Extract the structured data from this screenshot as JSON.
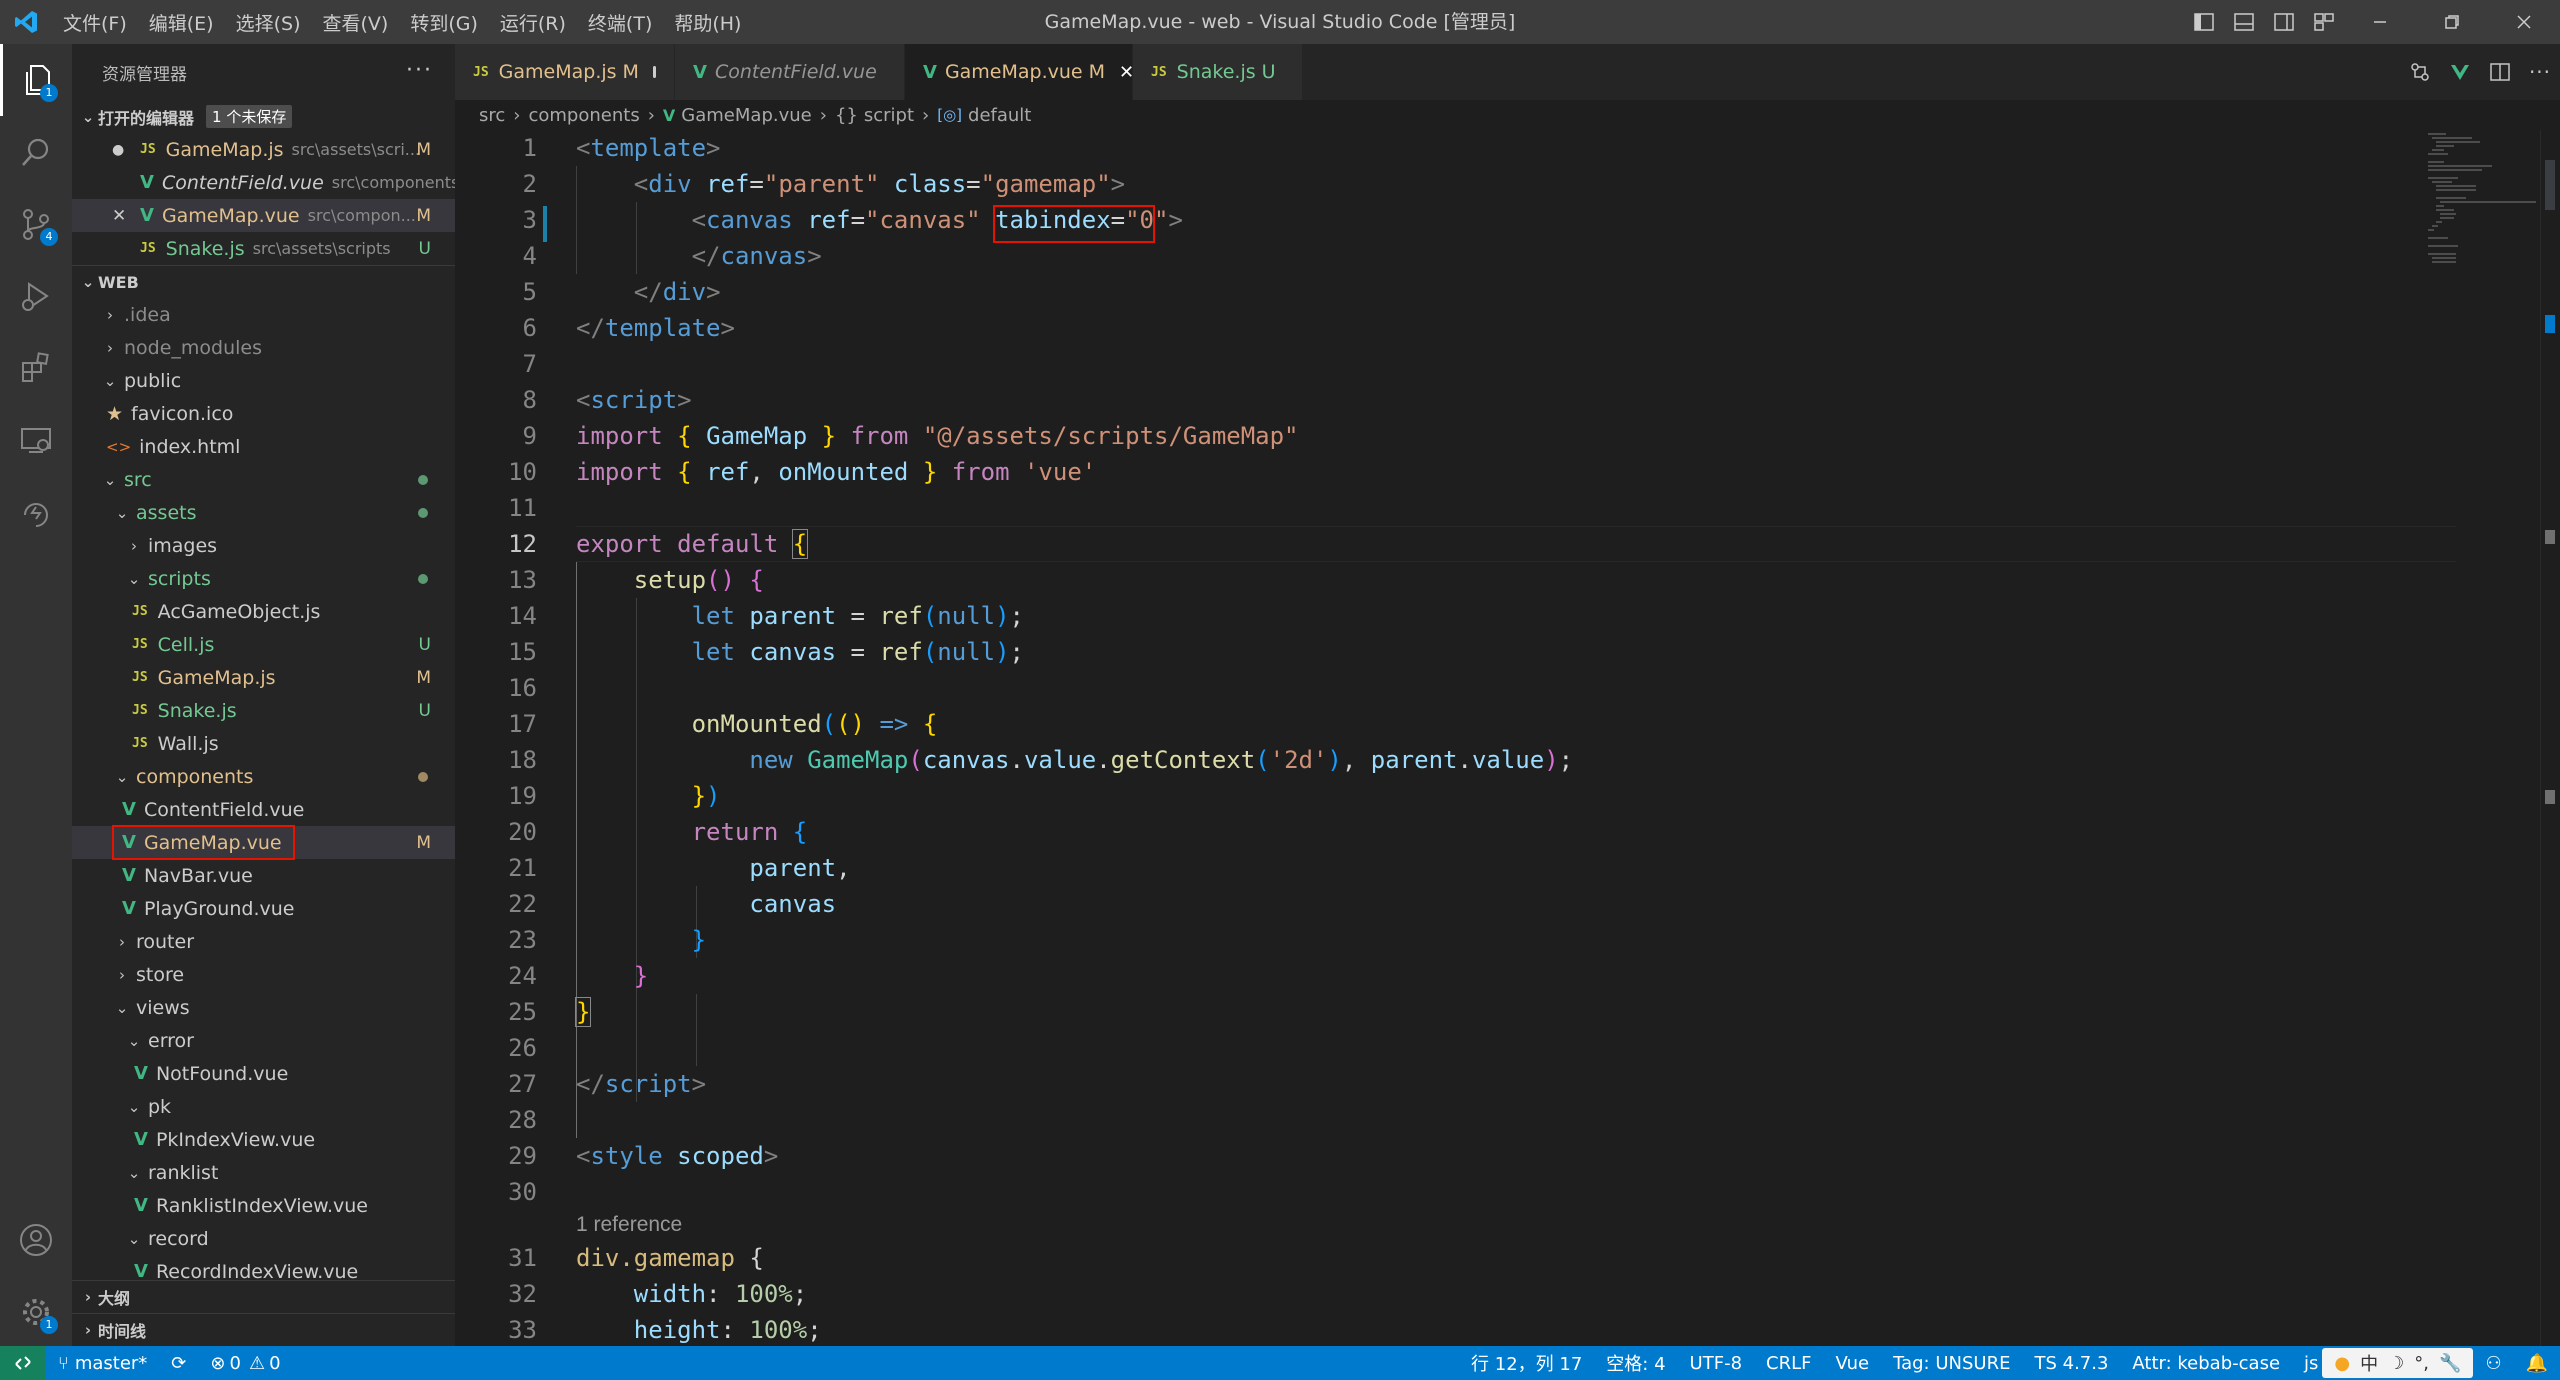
{
  "window": {
    "title": "GameMap.vue - web - Visual Studio Code [管理员]",
    "menu": [
      "文件(F)",
      "编辑(E)",
      "选择(S)",
      "查看(V)",
      "转到(G)",
      "运行(R)",
      "终端(T)",
      "帮助(H)"
    ]
  },
  "activity_bar": {
    "explorer_badge": "1",
    "scm_badge": "4",
    "settings_badge": "1"
  },
  "sidebar": {
    "header": "资源管理器",
    "more": "···",
    "open_editors": {
      "title": "打开的编辑器",
      "unsaved": "1 个未保存",
      "items": [
        {
          "name": "GameMap.js",
          "path": "src\\assets\\scri...",
          "status": "M",
          "lead": "●"
        },
        {
          "name": "ContentField.vue",
          "path": "src\\components",
          "status": "",
          "lead": ""
        },
        {
          "name": "GameMap.vue",
          "path": "src\\compon...",
          "status": "M",
          "lead": "✕"
        },
        {
          "name": "Snake.js",
          "path": "src\\assets\\scripts",
          "status": "U",
          "lead": ""
        }
      ]
    },
    "workspace": "WEB",
    "tree": {
      "idea": ".idea",
      "node_modules": "node_modules",
      "public": "public",
      "favicon": "favicon.ico",
      "index_html": "index.html",
      "src": "src",
      "assets": "assets",
      "images": "images",
      "scripts": "scripts",
      "acgameobject": "AcGameObject.js",
      "cell": "Cell.js",
      "gamemap_js": "GameMap.js",
      "snake": "Snake.js",
      "wall": "Wall.js",
      "components": "components",
      "contentfield": "ContentField.vue",
      "gamemap_vue": "GameMap.vue",
      "navbar": "NavBar.vue",
      "playground": "PlayGround.vue",
      "router": "router",
      "store": "store",
      "views": "views",
      "error": "error",
      "notfound": "NotFound.vue",
      "pk": "pk",
      "pkindex": "PkIndexView.vue",
      "ranklist": "ranklist",
      "ranklistindex": "RanklistIndexView.vue",
      "record": "record",
      "recordindex": "RecordIndexView.vue"
    },
    "status": {
      "U": "U",
      "M": "M"
    },
    "outline": "大纲",
    "timeline": "时间线"
  },
  "tabs": [
    {
      "name": "GameMap.js",
      "status": "M"
    },
    {
      "name": "ContentField.vue",
      "status": ""
    },
    {
      "name": "GameMap.vue",
      "status": "M"
    },
    {
      "name": "Snake.js",
      "status": "U"
    }
  ],
  "breadcrumb": {
    "src": "src",
    "components": "components",
    "file": "GameMap.vue",
    "script": "script",
    "script_icon": "{}",
    "symbol": "default"
  },
  "editor": {
    "current_line": 12,
    "codelens": "1 reference"
  },
  "statusbar": {
    "branch": "master*",
    "errors": "0",
    "warnings": "0",
    "position": "行 12，列 17",
    "spaces": "空格: 4",
    "encoding": "UTF-8",
    "eol": "CRLF",
    "language": "Vue",
    "tag": "Tag: UNSURE",
    "ts": "TS 4.7.3",
    "attr": "Attr: kebab-case",
    "js": "js",
    "ime": "中"
  },
  "colors": {
    "accent": "#007acc",
    "highlight_box": "#e51400",
    "modified": "#e2c08d",
    "untracked": "#73c991"
  }
}
